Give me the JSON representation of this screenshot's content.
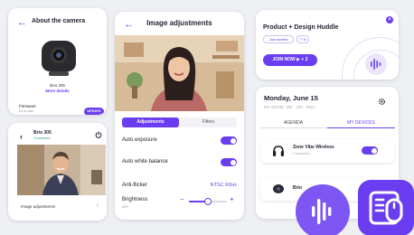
{
  "about_card": {
    "title": "About the camera",
    "model": "Brio 305",
    "more_details": "More details",
    "firmware_label": "Firmware",
    "firmware_status": "Up to date",
    "update_button": "UPDATE"
  },
  "preview_card": {
    "device_name": "Brio 305",
    "device_status": "Connected",
    "adjustments_link": "Image adjustments"
  },
  "adjust_card": {
    "title": "Image adjustments",
    "tabs": [
      "Adjustments",
      "Filters"
    ],
    "auto_exposure": {
      "label": "Auto exposure",
      "on": true
    },
    "auto_white_balance": {
      "label": "Auto white balance",
      "on": true
    },
    "anti_flicker": {
      "label": "Anti-flicker",
      "value": "NTSC 60Hz"
    },
    "brightness": {
      "label": "Brightness",
      "sub": "50%",
      "minus": "−",
      "plus": "+",
      "level": 0.5
    }
  },
  "meeting_card": {
    "title": "Product + Design Huddle",
    "status": "Just started",
    "participants": "8",
    "join_button": "JOIN NOW  ▶ + 2",
    "close": "×"
  },
  "agenda_card": {
    "date": "Monday, June 15",
    "zoom": "MY ZOOM: 155 · 234 · 5601",
    "tabs": [
      "AGENDA",
      "MY DEVICES"
    ],
    "devices": [
      {
        "name": "Zone Vibe Wireless",
        "status": "Connected",
        "on": true
      },
      {
        "name": "Brio",
        "status": "",
        "on": true
      }
    ]
  },
  "colors": {
    "accent": "#6a3df0",
    "background": "#eef0f4",
    "card": "#ffffff",
    "connected": "#2e9e6a"
  },
  "icons": [
    "back-arrow-icon",
    "power-icon",
    "chevron-right-icon",
    "close-icon",
    "gear-icon",
    "headphones-icon",
    "webcam-icon",
    "sound-wave-icon",
    "device-app-icon",
    "person-icon",
    "play-icon"
  ]
}
